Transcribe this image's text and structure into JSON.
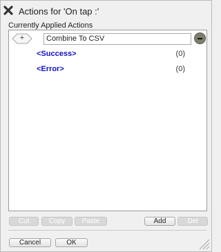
{
  "window": {
    "title": "Actions for 'On tap :'"
  },
  "section_label": "Currently Applied Actions",
  "action": {
    "add_glyph": "+",
    "name": "Combine To CSV",
    "remove_glyph": "–"
  },
  "branches": [
    {
      "label": "<Success>",
      "count": "(0)"
    },
    {
      "label": "<Error>",
      "count": "(0)"
    }
  ],
  "toolbar": {
    "cut": "Cut",
    "copy": "Copy",
    "paste": "Paste",
    "add": "Add",
    "del": "Del"
  },
  "footer": {
    "cancel": "Cancel",
    "ok": "OK"
  },
  "icons": {
    "close": "close-icon",
    "resize": "resize-grip-icon"
  },
  "colors": {
    "branch_text": "#1010c8",
    "remove_button": "#7e7e6e"
  }
}
